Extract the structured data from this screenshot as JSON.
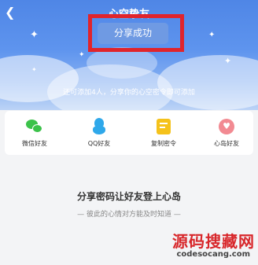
{
  "header": {
    "back_icon": "chevron-left-icon",
    "title": "心空挚友"
  },
  "toast": {
    "text": "分享成功",
    "highlight_color": "#e0242c"
  },
  "hint": "还可添加4人，分享你的心空密令即可添加",
  "share_options": [
    {
      "label": "微信好友",
      "icon": "wechat-icon",
      "color": "#3cc24a"
    },
    {
      "label": "QQ好友",
      "icon": "qq-icon",
      "color": "#2fa8ea"
    },
    {
      "label": "复制密令",
      "icon": "copy-icon",
      "color": "#f5c21b"
    },
    {
      "label": "心岛好友",
      "icon": "island-icon",
      "color": "#f28a92"
    }
  ],
  "promo": {
    "headline": "分享密码让好友登上心岛",
    "subline": "— 彼此的心情对方能及时知道 —"
  },
  "watermark": {
    "brand": "源码搜藏网",
    "url": "codesocang.com"
  }
}
